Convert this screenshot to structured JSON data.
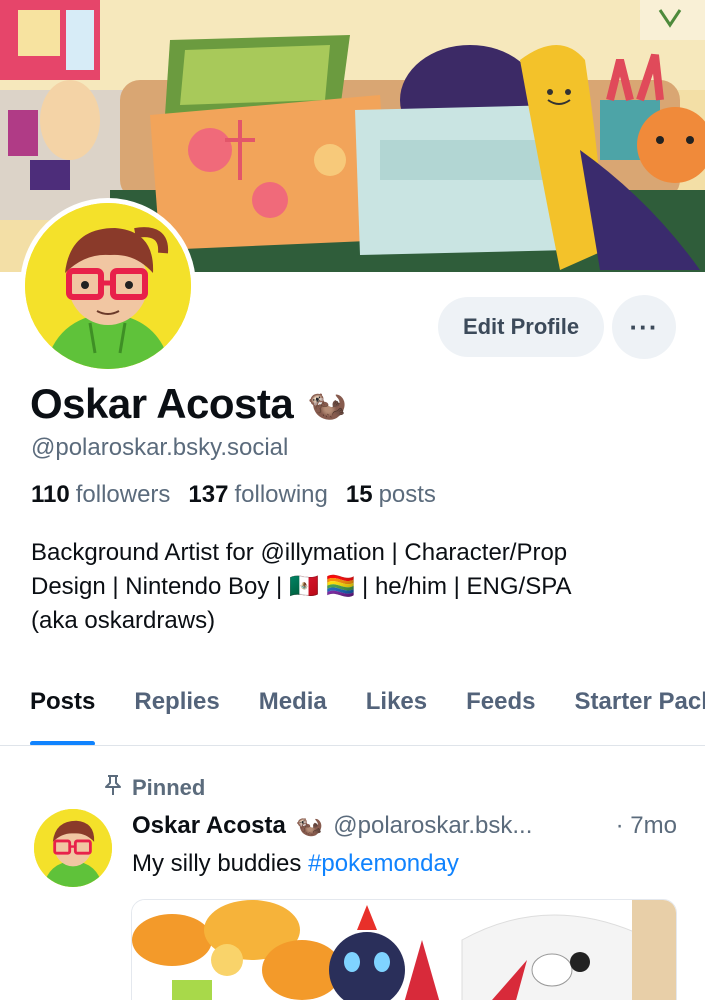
{
  "profile": {
    "display_name": "Oskar Acosta",
    "name_emoji": "🦦",
    "handle": "@polaroskar.bsky.social",
    "edit_button": "Edit Profile",
    "more_button": "···",
    "stats": {
      "followers_count": "110",
      "followers_label": "followers",
      "following_count": "137",
      "following_label": "following",
      "posts_count": "15",
      "posts_label": "posts"
    },
    "bio_line1": "Background Artist for @illymation | Character/Prop",
    "bio_line2": "Design | Nintendo Boy | 🇲🇽 🏳️‍🌈 | he/him | ENG/SPA",
    "bio_line3": "(aka oskardraws)"
  },
  "tabs": [
    "Posts",
    "Replies",
    "Media",
    "Likes",
    "Feeds",
    "Starter Packs"
  ],
  "active_tab": "Posts",
  "post": {
    "pinned_label": "Pinned",
    "author": "Oskar Acosta",
    "author_emoji": "🦦",
    "handle": "@polaroskar.bsk...",
    "time": "· 7mo",
    "text_prefix": "My silly buddies ",
    "hashtag": "#pokemonday"
  },
  "colors": {
    "accent": "#1083fe",
    "muted_text": "#5b6b7c",
    "button_bg": "#eef2f6",
    "avatar_bg": "#f4e12a"
  },
  "icons": {
    "pin": "pin-icon",
    "more": "ellipsis-icon"
  }
}
